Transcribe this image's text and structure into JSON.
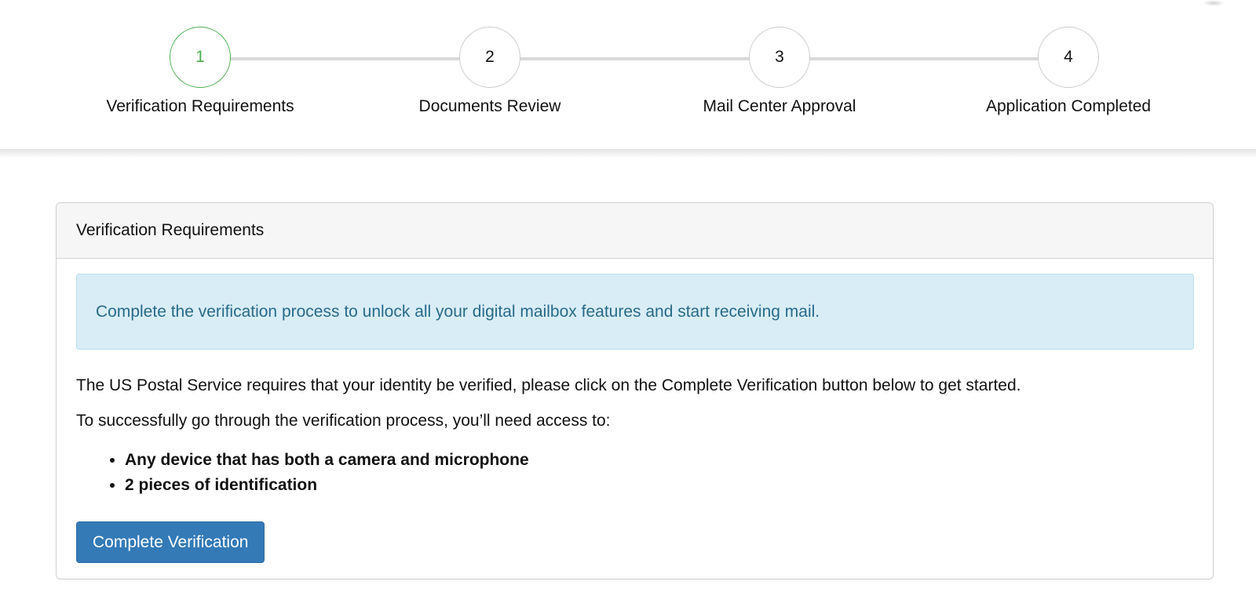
{
  "stepper": {
    "steps": [
      {
        "number": "1",
        "label": "Verification Requirements",
        "state": "active"
      },
      {
        "number": "2",
        "label": "Documents Review",
        "state": "pending"
      },
      {
        "number": "3",
        "label": "Mail Center Approval",
        "state": "pending"
      },
      {
        "number": "4",
        "label": "Application Completed",
        "state": "pending"
      }
    ],
    "active_color": "#4caf50",
    "line_color": "#d9d9d9"
  },
  "panel": {
    "title": "Verification Requirements",
    "alert": "Complete the verification process to unlock all your digital mailbox features and start receiving mail.",
    "paragraph_1": "The US Postal Service requires that your identity be verified, please click on the Complete Verification button below to get started.",
    "paragraph_2": "To successfully go through the verification process, you’ll need access to:",
    "requirements": [
      "Any device that has both a camera and microphone",
      "2 pieces of identification"
    ],
    "button_label": "Complete Verification"
  },
  "colors": {
    "primary_button": "#337ab7",
    "alert_background": "#d9edf7",
    "alert_text": "#276a8a"
  }
}
